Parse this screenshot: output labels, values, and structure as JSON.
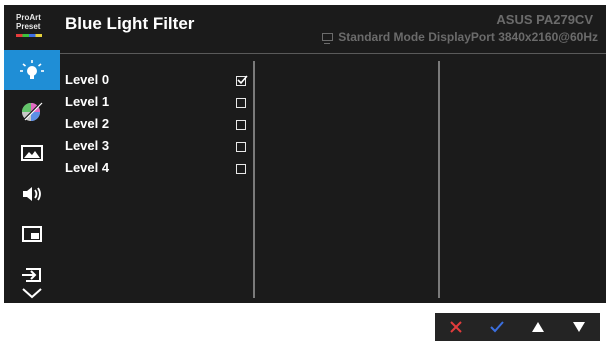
{
  "sidebar": {
    "preset_line1": "ProArt",
    "preset_line2": "Preset",
    "items": [
      {
        "name": "blue-light-filter",
        "icon": "bulb-icon",
        "active": true
      },
      {
        "name": "color",
        "icon": "color-wheel-icon",
        "active": false
      },
      {
        "name": "image",
        "icon": "image-icon",
        "active": false
      },
      {
        "name": "sound",
        "icon": "speaker-icon",
        "active": false
      },
      {
        "name": "pip",
        "icon": "pip-icon",
        "active": false
      },
      {
        "name": "input",
        "icon": "input-icon",
        "active": false
      },
      {
        "name": "more",
        "icon": "chevron-down-icon",
        "active": false
      }
    ]
  },
  "header": {
    "title": "Blue Light Filter",
    "model": "ASUS PA279CV",
    "mode_info": "Standard Mode DisplayPort 3840x2160@60Hz"
  },
  "levels": [
    {
      "label": "Level 0",
      "checked": true
    },
    {
      "label": "Level 1",
      "checked": false
    },
    {
      "label": "Level 2",
      "checked": false
    },
    {
      "label": "Level 3",
      "checked": false
    },
    {
      "label": "Level 4",
      "checked": false
    }
  ],
  "buttons": [
    "close-icon",
    "check-icon",
    "up-triangle-icon",
    "down-triangle-icon"
  ],
  "colors": {
    "accent": "#1f8ed6",
    "panel": "#1b1b1b",
    "close": "#e23c3c",
    "confirm": "#3b6fe0"
  }
}
